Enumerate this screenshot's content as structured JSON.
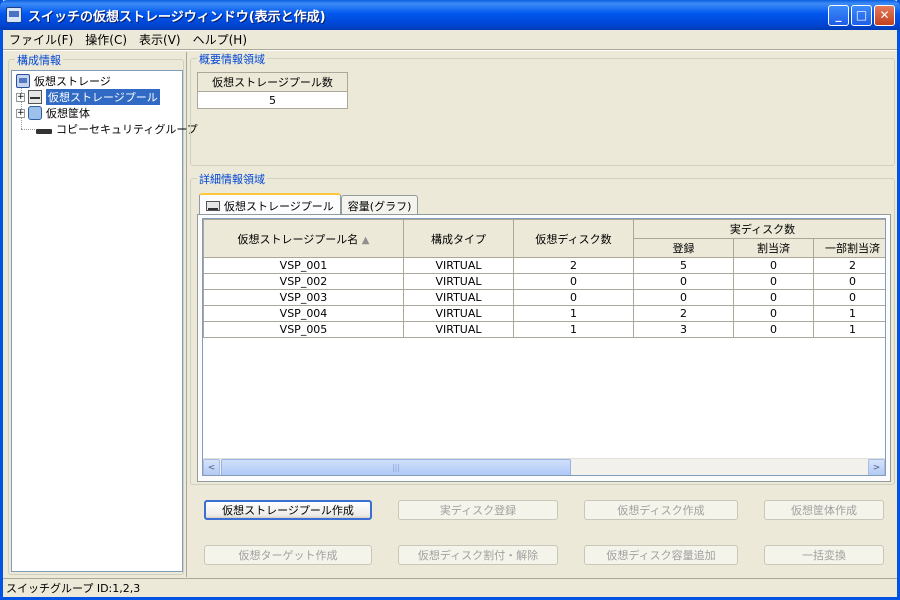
{
  "window": {
    "title": "スイッチの仮想ストレージウィンドウ(表示と作成)",
    "controls": {
      "minimize": "_",
      "maximize": "□",
      "close": "✕"
    }
  },
  "menu": [
    "ファイル(F)",
    "操作(C)",
    "表示(V)",
    "ヘルプ(H)"
  ],
  "left": {
    "group_label": "構成情報",
    "tree": {
      "root": "仮想ストレージ",
      "items": [
        {
          "label": "仮想ストレージプール",
          "selected": true,
          "expander": "+"
        },
        {
          "label": "仮想筐体",
          "selected": false,
          "expander": "+"
        },
        {
          "label": "コピーセキュリティグループ",
          "selected": false
        }
      ]
    }
  },
  "summary": {
    "group_label": "概要情報領域",
    "header": "仮想ストレージプール数",
    "value": "5"
  },
  "detail": {
    "group_label": "詳細情報領域",
    "tabs": [
      {
        "label": "仮想ストレージプール",
        "active": true
      },
      {
        "label": "容量(グラフ)",
        "active": false
      }
    ],
    "columns": {
      "name": "仮想ストレージプール名",
      "sort_indicator": "▲",
      "type": "構成タイプ",
      "vdisk": "仮想ディスク数",
      "real_disk_group": "実ディスク数",
      "registered": "登録",
      "allocated": "割当済",
      "partial": "一部割当済"
    },
    "rows": [
      {
        "name": "VSP_001",
        "type": "VIRTUAL",
        "vdisk": "2",
        "registered": "5",
        "allocated": "0",
        "partial": "2"
      },
      {
        "name": "VSP_002",
        "type": "VIRTUAL",
        "vdisk": "0",
        "registered": "0",
        "allocated": "0",
        "partial": "0"
      },
      {
        "name": "VSP_003",
        "type": "VIRTUAL",
        "vdisk": "0",
        "registered": "0",
        "allocated": "0",
        "partial": "0"
      },
      {
        "name": "VSP_004",
        "type": "VIRTUAL",
        "vdisk": "1",
        "registered": "2",
        "allocated": "0",
        "partial": "1"
      },
      {
        "name": "VSP_005",
        "type": "VIRTUAL",
        "vdisk": "1",
        "registered": "3",
        "allocated": "0",
        "partial": "1"
      }
    ],
    "scroll": {
      "left": "<",
      "right": ">",
      "grip": "|||"
    }
  },
  "buttons": {
    "create_pool": "仮想ストレージプール作成",
    "register_disk": "実ディスク登録",
    "create_vdisk": "仮想ディスク作成",
    "create_chassis": "仮想筐体作成",
    "create_target": "仮想ターゲット作成",
    "assign_vdisk": "仮想ディスク割付・解除",
    "expand_vdisk": "仮想ディスク容量追加",
    "bulk_convert": "一括変換"
  },
  "status": "スイッチグループ ID:1,2,3"
}
